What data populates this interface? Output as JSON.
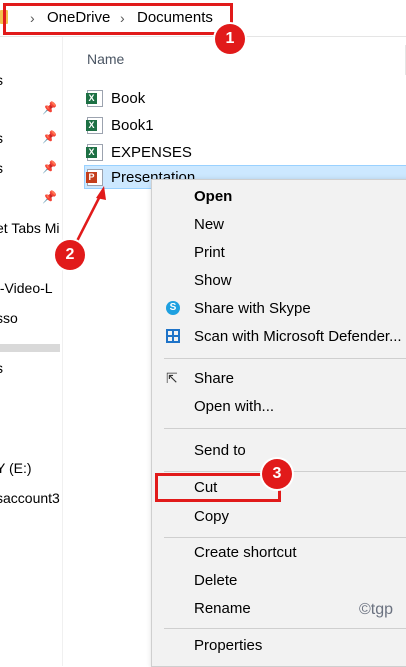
{
  "breadcrumb": {
    "root": "OneDrive",
    "current": "Documents"
  },
  "nav": {
    "items": [
      "s",
      "s",
      "s",
      "et Tabs Mi",
      "t-Video-L",
      "sso",
      "s",
      "Y (E:)",
      "saccount3"
    ]
  },
  "list": {
    "column_header": "Name",
    "files": [
      {
        "name": "Book",
        "type": "excel"
      },
      {
        "name": "Book1",
        "type": "excel"
      },
      {
        "name": "EXPENSES",
        "type": "excel"
      },
      {
        "name": "Presentation",
        "type": "powerpoint"
      }
    ]
  },
  "context_menu": {
    "items": [
      "Open",
      "New",
      "Print",
      "Show",
      "Share with Skype",
      "Scan with Microsoft Defender...",
      "Share",
      "Open with...",
      "Send to",
      "Cut",
      "Copy",
      "Create shortcut",
      "Delete",
      "Rename",
      "Properties"
    ]
  },
  "annotations": {
    "badge1": "1",
    "badge2": "2",
    "badge3": "3",
    "color": "#e11a1a"
  },
  "watermark": "©tgp"
}
